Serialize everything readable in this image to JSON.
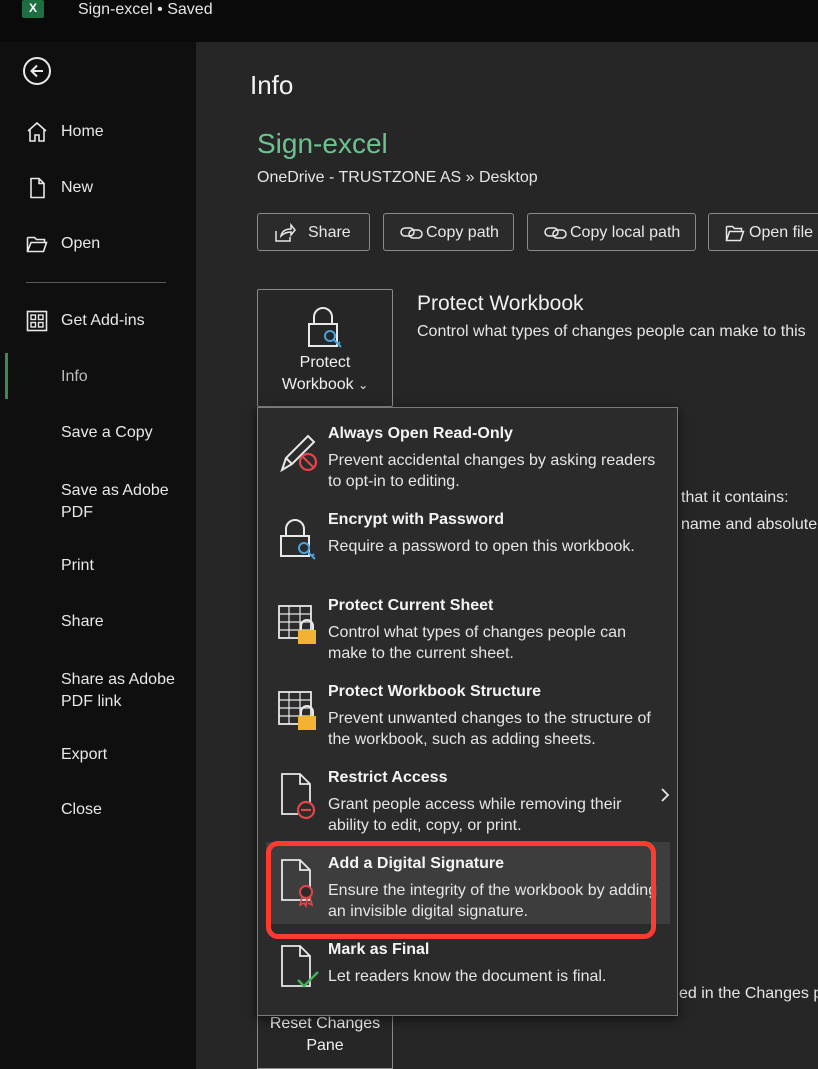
{
  "titlebar": {
    "app_icon_letter": "X",
    "document": "Sign-excel",
    "separator": "•",
    "status": "Saved"
  },
  "sidebar": {
    "back_icon": "back-arrow-icon",
    "items": [
      {
        "label": "Home",
        "icon": "home-icon"
      },
      {
        "label": "New",
        "icon": "new-document-icon"
      },
      {
        "label": "Open",
        "icon": "folder-open-icon"
      },
      {
        "label": "Get Add-ins",
        "icon": "grid-icon"
      },
      {
        "label": "Info"
      },
      {
        "label": "Save a Copy"
      },
      {
        "label": "Save as Adobe PDF"
      },
      {
        "label": "Print"
      },
      {
        "label": "Share"
      },
      {
        "label": "Share as Adobe PDF link"
      },
      {
        "label": "Export"
      },
      {
        "label": "Close"
      }
    ],
    "active": "Info"
  },
  "main": {
    "title": "Info",
    "file_name": "Sign-excel",
    "file_path": "OneDrive - TRUSTZONE AS » Desktop",
    "actions": [
      {
        "label": "Share",
        "icon": "share-icon"
      },
      {
        "label": "Copy path",
        "icon": "link-icon"
      },
      {
        "label": "Copy local path",
        "icon": "link-icon"
      },
      {
        "label": "Open file",
        "icon": "folder-open-icon"
      }
    ],
    "protect_tile": {
      "line1": "Protect",
      "line2": "Workbook",
      "chevron": "⌄"
    },
    "protect_section": {
      "title": "Protect Workbook",
      "desc": "Control what types of changes people can make to this"
    },
    "bg_fragments": {
      "line1": "that it contains:",
      "line2": "name and absolute",
      "line3": "ed in the Changes p"
    },
    "reset_tile": {
      "line1": "Reset Changes",
      "line2": "Pane"
    }
  },
  "menu": [
    {
      "title": "Always Open Read-Only",
      "desc": "Prevent accidental changes by asking readers to opt-in to editing.",
      "icon": "pencil-blocked-icon"
    },
    {
      "title": "Encrypt with Password",
      "desc": "Require a password to open this workbook.",
      "icon": "lock-key-icon"
    },
    {
      "title": "Protect Current Sheet",
      "desc": "Control what types of changes people can make to the current sheet.",
      "icon": "sheet-lock-icon"
    },
    {
      "title": "Protect Workbook Structure",
      "desc": "Prevent unwanted changes to the structure of the workbook, such as adding sheets.",
      "icon": "workbook-lock-icon"
    },
    {
      "title": "Restrict Access",
      "desc": "Grant people access while removing their ability to edit, copy, or print.",
      "icon": "document-restrict-icon",
      "submenu": "›"
    },
    {
      "title": "Add a Digital Signature",
      "desc": "Ensure the integrity of the workbook by adding an invisible digital signature.",
      "icon": "document-ribbon-icon"
    },
    {
      "title": "Mark as Final",
      "desc": "Let readers know the document is final.",
      "icon": "document-check-icon"
    }
  ],
  "colors": {
    "accent_green": "#6cc38e",
    "highlight_red": "#ff3b30",
    "excel_green": "#1d6f42"
  }
}
